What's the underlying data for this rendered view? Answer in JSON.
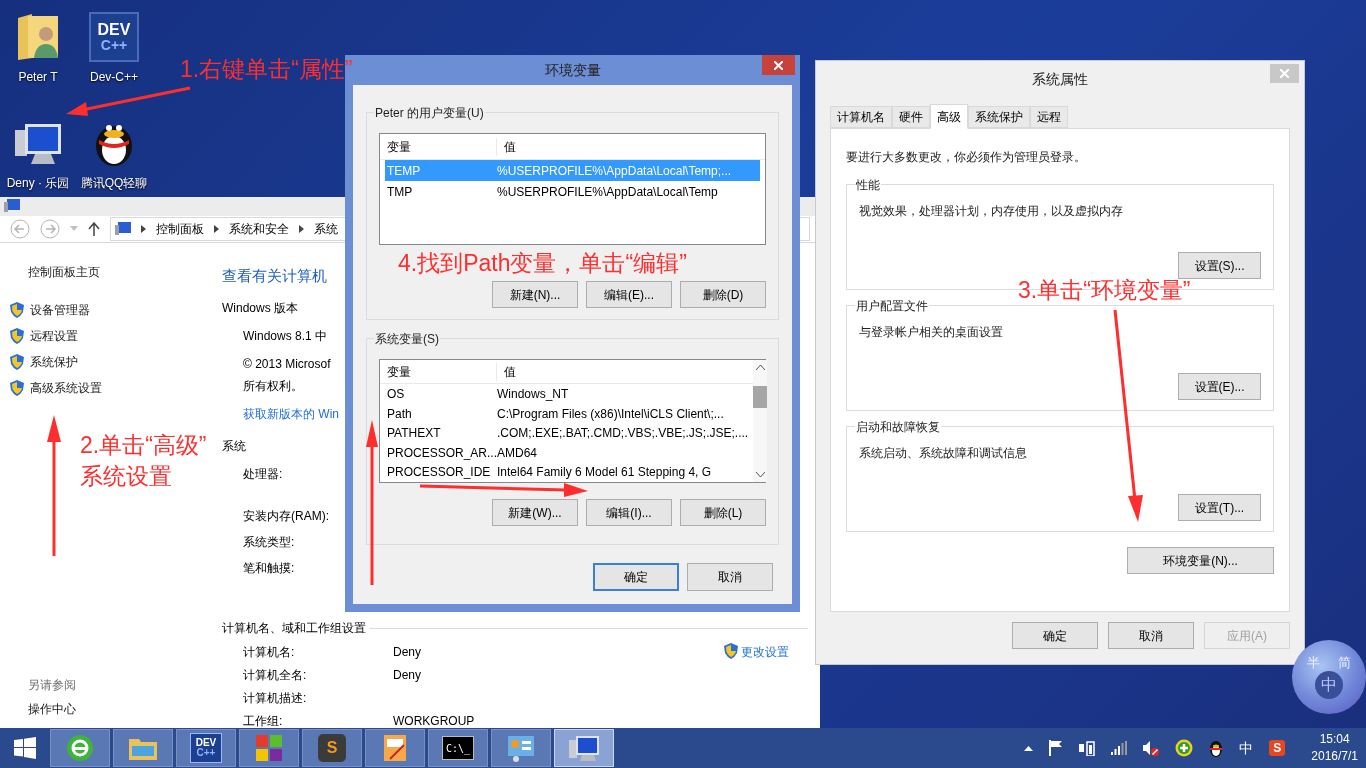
{
  "desktop_icons": [
    {
      "label": "Peter T",
      "kind": "user-folder"
    },
    {
      "label": "Deny · 乐园",
      "kind": "computer"
    },
    {
      "label": "Dev-C++",
      "kind": "devcpp",
      "glyph_top": "DEV",
      "glyph_bottom": "C++"
    },
    {
      "label": "腾讯QQ轻聊",
      "kind": "penguin"
    }
  ],
  "control_panel": {
    "breadcrumb": [
      "控制面板",
      "系统和安全",
      "系统"
    ],
    "home_link": "控制面板主页",
    "tasks": [
      "设备管理器",
      "远程设置",
      "系统保护",
      "高级系统设置"
    ],
    "see_also_title": "另请参阅",
    "see_also": [
      "操作中心"
    ],
    "heading": "查看有关计算机",
    "edition": {
      "title": "Windows 版本",
      "name": "Windows 8.1 中",
      "copyright": "© 2013 Microsof",
      "rights": "所有权利。",
      "link": "获取新版本的 Win"
    },
    "system": {
      "title": "系统",
      "labels": [
        "处理器:",
        "安装内存(RAM):",
        "系统类型:",
        "笔和触摸:"
      ]
    },
    "computer": {
      "title": "计算机名、域和工作组设置",
      "change_link": "更改设置",
      "rows": [
        {
          "label": "计算机名:",
          "value": "Deny"
        },
        {
          "label": "计算机全名:",
          "value": "Deny"
        },
        {
          "label": "计算机描述:",
          "value": ""
        },
        {
          "label": "工作组:",
          "value": "WORKGROUP"
        }
      ]
    }
  },
  "env_dialog": {
    "title": "环境变量",
    "user_group": {
      "title": "Peter 的用户变量(U)",
      "columns": [
        "变量",
        "值"
      ],
      "rows": [
        {
          "name": "TEMP",
          "value": "%USERPROFILE%\\AppData\\Local\\Temp;...",
          "selected": true
        },
        {
          "name": "TMP",
          "value": "%USERPROFILE%\\AppData\\Local\\Temp",
          "selected": false
        }
      ],
      "buttons": [
        "新建(N)...",
        "编辑(E)...",
        "删除(D)"
      ]
    },
    "system_group": {
      "title": "系统变量(S)",
      "columns": [
        "变量",
        "值"
      ],
      "rows": [
        {
          "name": "OS",
          "value": "Windows_NT",
          "selected": false
        },
        {
          "name": "Path",
          "value": "C:\\Program Files (x86)\\Intel\\iCLS Client\\;...",
          "selected": false
        },
        {
          "name": "PATHEXT",
          "value": ".COM;.EXE;.BAT;.CMD;.VBS;.VBE;.JS;.JSE;....",
          "selected": false
        },
        {
          "name": "PROCESSOR_AR...",
          "value": "AMD64",
          "selected": false
        },
        {
          "name": "PROCESSOR_IDE",
          "value": "Intel64 Family 6 Model 61 Stepping 4, G",
          "selected": false
        }
      ],
      "buttons": [
        "新建(W)...",
        "编辑(I)...",
        "删除(L)"
      ]
    },
    "buttons": [
      {
        "label": "确定",
        "default": true
      },
      {
        "label": "取消",
        "default": false
      }
    ]
  },
  "system_properties": {
    "title": "系统属性",
    "tabs": [
      {
        "label": "计算机名",
        "selected": false
      },
      {
        "label": "硬件",
        "selected": false
      },
      {
        "label": "高级",
        "selected": true
      },
      {
        "label": "系统保护",
        "selected": false
      },
      {
        "label": "远程",
        "selected": false
      }
    ],
    "admin_note": "要进行大多数更改，你必须作为管理员登录。",
    "groups": [
      {
        "title": "性能",
        "description": "视觉效果，处理器计划，内存使用，以及虚拟内存",
        "button": "设置(S)..."
      },
      {
        "title": "用户配置文件",
        "description": "与登录帐户相关的桌面设置",
        "button": "设置(E)..."
      },
      {
        "title": "启动和故障恢复",
        "description": "系统启动、系统故障和调试信息",
        "button": "设置(T)..."
      }
    ],
    "env_button": "环境变量(N)...",
    "buttons": [
      {
        "label": "确定",
        "disabled": false
      },
      {
        "label": "取消",
        "disabled": false
      },
      {
        "label": "应用(A)",
        "disabled": true
      }
    ]
  },
  "annotations": [
    {
      "lines": [
        "1.右键单击“属性”"
      ]
    },
    {
      "lines": [
        "2.单击“高级”",
        "系统设置"
      ]
    },
    {
      "lines": [
        "3.单击“环境变量”"
      ]
    },
    {
      "lines": [
        "4.找到Path变量，单击“编辑”"
      ]
    }
  ],
  "ime_skin": {
    "chars": [
      "半",
      "简",
      "中"
    ]
  },
  "taskbar": {
    "apps": [
      {
        "kind": "ie",
        "selected": false
      },
      {
        "kind": "explorer",
        "selected": false
      },
      {
        "kind": "devcpp",
        "glyph": "DEV",
        "glyph2": "C++",
        "selected": false
      },
      {
        "kind": "blocks",
        "selected": false
      },
      {
        "kind": "sublime",
        "glyph": "S",
        "selected": false
      },
      {
        "kind": "notes",
        "selected": false
      },
      {
        "kind": "cmd",
        "glyph": "C:\\_",
        "selected": false
      },
      {
        "kind": "panel",
        "selected": false
      },
      {
        "kind": "computer",
        "selected": true
      }
    ],
    "tray": [
      {
        "kind": "caret"
      },
      {
        "kind": "flag"
      },
      {
        "kind": "battery"
      },
      {
        "kind": "signal"
      },
      {
        "kind": "muted"
      },
      {
        "kind": "plus"
      },
      {
        "kind": "penguin"
      },
      {
        "kind": "text",
        "glyph": "中"
      },
      {
        "kind": "sogou",
        "glyph": "S"
      }
    ],
    "time": "15:04",
    "date": "2016/7/1"
  }
}
